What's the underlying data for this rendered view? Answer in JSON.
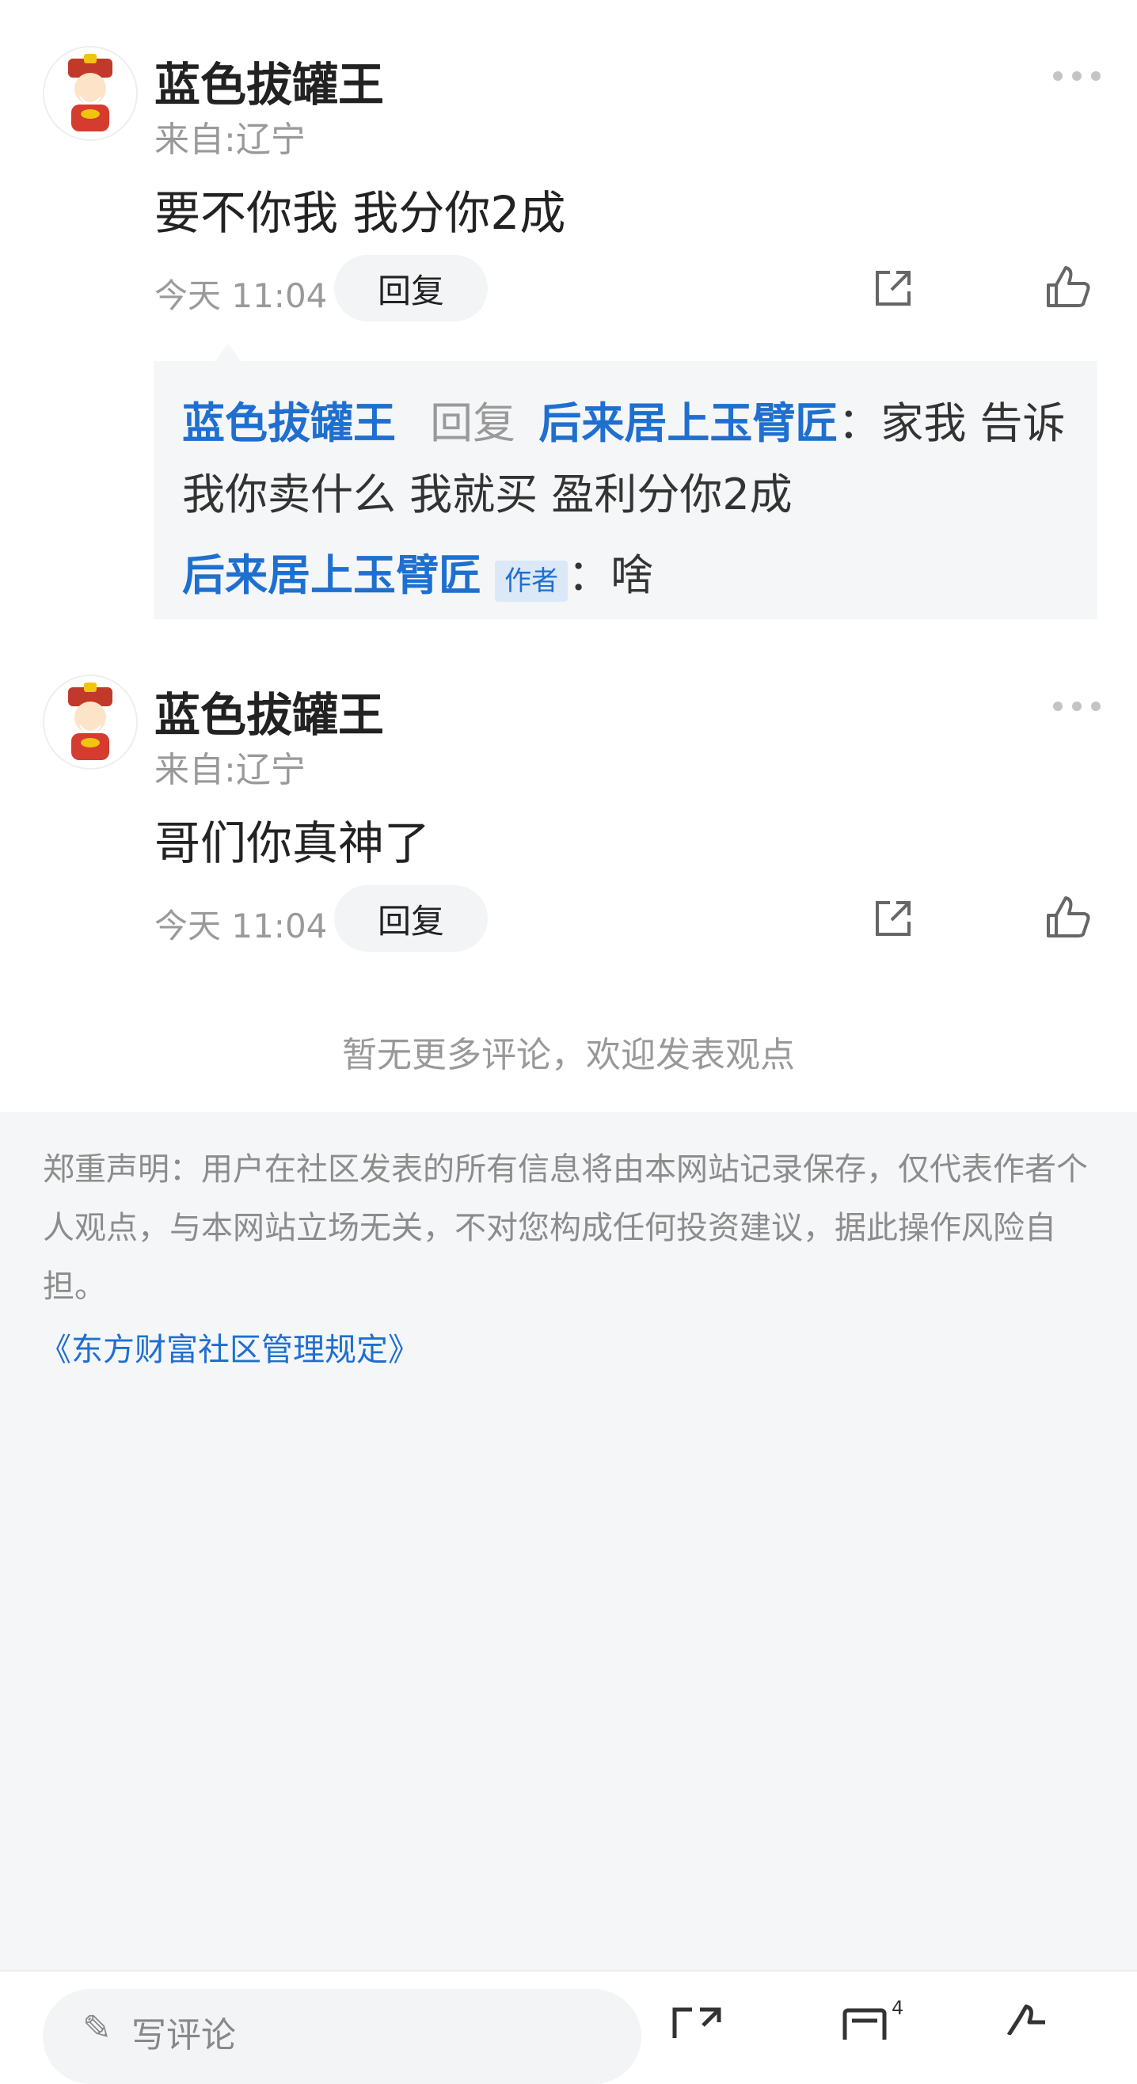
{
  "comments": [
    {
      "author": "蓝色拔罐王",
      "location": "来自:辽宁",
      "content": "要不你我 我分你2成",
      "time": "今天 11:04",
      "reply_label": "回复",
      "sub_replies": {
        "line1": {
          "from": "蓝色拔罐王",
          "verb": "回复",
          "to": "后来居上玉臂匠",
          "text_part1": "：家我 告诉",
          "text_part2": "我你卖什么 我就买 盈利分你2成"
        },
        "line2": {
          "from": "后来居上玉臂匠",
          "tag": "作者",
          "text": "：啥"
        }
      }
    },
    {
      "author": "蓝色拔罐王",
      "location": "来自:辽宁",
      "content": "哥们你真神了",
      "time": "今天 11:04",
      "reply_label": "回复"
    }
  ],
  "no_more": "暂无更多评论，欢迎发表观点",
  "disclaimer": "郑重声明：用户在社区发表的所有信息将由本网站记录保存，仅代表作者个人观点，与本网站立场无关，不对您构成任何投资建议，据此操作风险自担。",
  "rules_link": "《东方财富社区管理规定》",
  "bottom_bar": {
    "input_placeholder": "写评论",
    "comment_badge": "4"
  },
  "colors": {
    "link_blue": "#1f6fcf",
    "footer_bg": "#f5f6f8"
  }
}
